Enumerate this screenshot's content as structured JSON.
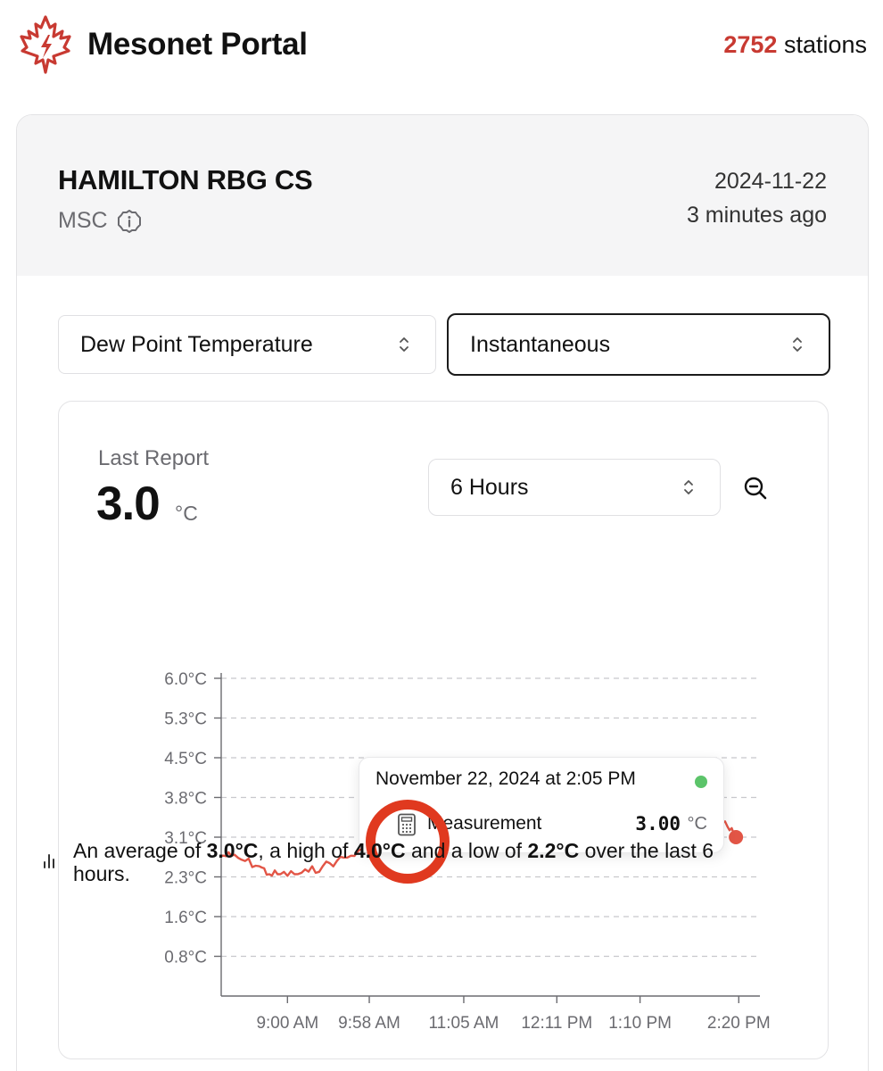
{
  "header": {
    "app_title": "Mesonet Portal",
    "station_count": "2752",
    "station_count_suffix": "stations",
    "accent_color": "#c83a32"
  },
  "station": {
    "name": "HAMILTON RBG CS",
    "network": "MSC",
    "date": "2024-11-22",
    "updated": "3 minutes ago"
  },
  "controls": {
    "parameter": "Dew Point Temperature",
    "aggregation": "Instantaneous",
    "range": "6 Hours"
  },
  "last_report": {
    "label": "Last Report",
    "value": "3.0",
    "unit": "°C"
  },
  "chart_data": {
    "type": "line",
    "ytick_labels": [
      "6.0°C",
      "5.3°C",
      "4.5°C",
      "3.8°C",
      "3.1°C",
      "2.3°C",
      "1.6°C",
      "0.8°C"
    ],
    "yticks": [
      6.0,
      5.25,
      4.5,
      3.75,
      3.0,
      2.25,
      1.5,
      0.75
    ],
    "ylim": [
      0,
      6.0
    ],
    "xtick_labels": [
      "9:00 AM",
      "9:58 AM",
      "11:05 AM",
      "12:11 PM",
      "1:10 PM",
      "2:20 PM"
    ],
    "xtick_minutes": [
      540,
      598,
      665,
      731,
      790,
      860
    ],
    "xlim": [
      493,
      875
    ],
    "grid": "horizontal dashed",
    "series": [
      {
        "color": "#e25546",
        "x": [
          493,
          500,
          510,
          520,
          527,
          535,
          545,
          555,
          565,
          575,
          585,
          595,
          605,
          615,
          625,
          635,
          645,
          655,
          662,
          667,
          672,
          678,
          685,
          692,
          700,
          707,
          714,
          722,
          729,
          737,
          745,
          752,
          759,
          767,
          775,
          782,
          790,
          798,
          806,
          814,
          822,
          830,
          837,
          845,
          852,
          858
        ],
        "y": [
          2.65,
          2.65,
          2.55,
          2.45,
          2.3,
          2.3,
          2.3,
          2.35,
          2.45,
          2.55,
          2.65,
          2.75,
          2.85,
          2.95,
          3.05,
          3.05,
          3.15,
          3.2,
          3.35,
          3.65,
          3.95,
          3.75,
          3.7,
          3.55,
          3.45,
          3.3,
          3.2,
          3.1,
          3.2,
          3.3,
          3.15,
          3.25,
          3.3,
          3.2,
          3.4,
          3.5,
          3.65,
          3.7,
          3.55,
          3.45,
          3.4,
          3.35,
          3.4,
          3.25,
          3.2,
          3.0
        ]
      }
    ],
    "last_point": {
      "x": 858,
      "y": 3.0
    }
  },
  "tooltip": {
    "datetime": "November 22, 2024 at 2:05 PM",
    "label": "Measurement",
    "value": "3.00",
    "unit": "°C",
    "status_color": "#5cc46a"
  },
  "summary": {
    "prefix": "An average of ",
    "average": "3.0°C",
    "mid1": ", a high of ",
    "high": "4.0°C",
    "mid2": " and a low of ",
    "low": "2.2°C",
    "suffix": " over the last 6 hours."
  }
}
